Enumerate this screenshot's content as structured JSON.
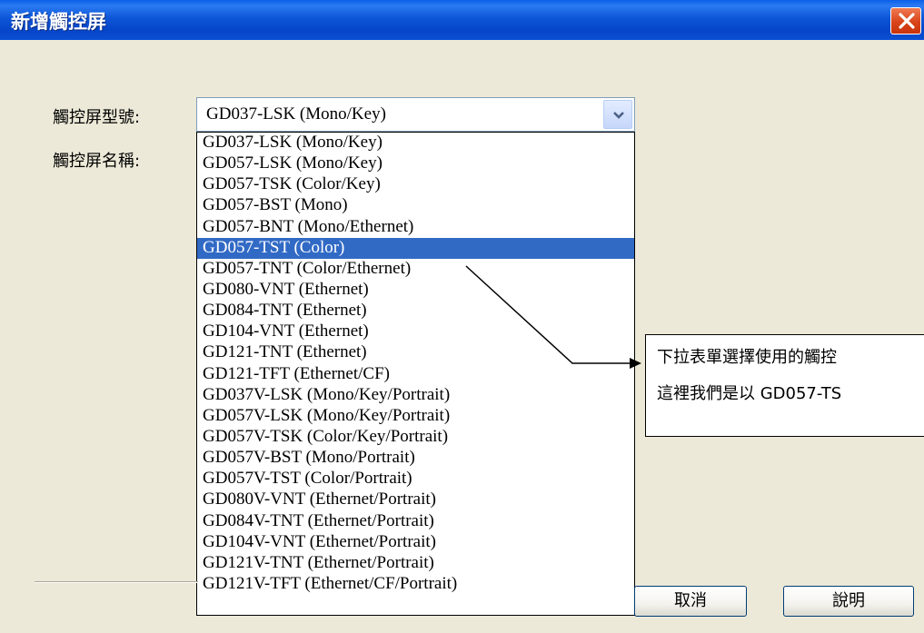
{
  "window": {
    "title": "新增觸控屏"
  },
  "form": {
    "model_label": "觸控屏型號:",
    "name_label": "觸控屏名稱:",
    "model_selected": "GD037-LSK (Mono/Key)"
  },
  "dropdown": {
    "items": [
      "GD037-LSK (Mono/Key)",
      "GD057-LSK (Mono/Key)",
      "GD057-TSK (Color/Key)",
      "GD057-BST (Mono)",
      "GD057-BNT (Mono/Ethernet)",
      "GD057-TST (Color)",
      "GD057-TNT (Color/Ethernet)",
      "GD080-VNT (Ethernet)",
      "GD084-TNT (Ethernet)",
      "GD104-VNT (Ethernet)",
      "GD121-TNT (Ethernet)",
      "GD121-TFT (Ethernet/CF)",
      "GD037V-LSK (Mono/Key/Portrait)",
      "GD057V-LSK (Mono/Key/Portrait)",
      "GD057V-TSK (Color/Key/Portrait)",
      "GD057V-BST (Mono/Portrait)",
      "GD057V-TST (Color/Portrait)",
      "GD080V-VNT (Ethernet/Portrait)",
      "GD084V-TNT (Ethernet/Portrait)",
      "GD104V-VNT (Ethernet/Portrait)",
      "GD121V-TNT (Ethernet/Portrait)",
      "GD121V-TFT (Ethernet/CF/Portrait)"
    ],
    "selected_index": 5
  },
  "buttons": {
    "cancel": "取消",
    "help": "說明"
  },
  "callout": {
    "line1": "下拉表單選擇使用的觸控",
    "line2": "這裡我們是以 GD057-TS"
  },
  "colors": {
    "titlebar": "#0a4fd4",
    "selection": "#316ac5",
    "close_button": "#d9441a",
    "dialog_bg": "#ece9d8"
  }
}
